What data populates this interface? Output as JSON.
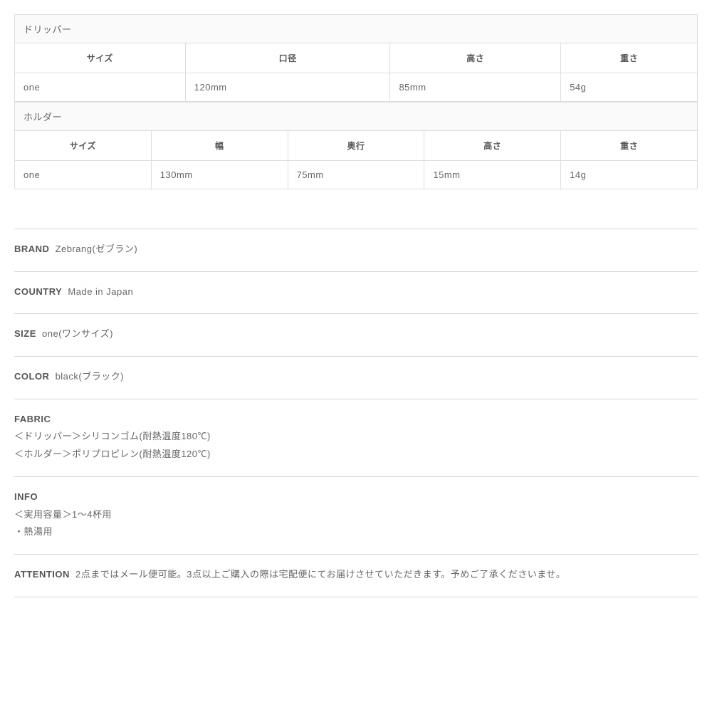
{
  "tables": [
    {
      "title": "ドリッパー",
      "headers": [
        "サイズ",
        "口径",
        "高さ",
        "重さ"
      ],
      "row": [
        "one",
        "120mm",
        "85mm",
        "54g"
      ]
    },
    {
      "title": "ホルダー",
      "headers": [
        "サイズ",
        "幅",
        "奥行",
        "高さ",
        "重さ"
      ],
      "row": [
        "one",
        "130mm",
        "75mm",
        "15mm",
        "14g"
      ]
    }
  ],
  "details": [
    {
      "label": "BRAND",
      "lines": [
        "Zebrang(ゼブラン)"
      ],
      "inline": true
    },
    {
      "label": "COUNTRY",
      "lines": [
        "Made in Japan"
      ],
      "inline": true
    },
    {
      "label": "SIZE",
      "lines": [
        "one(ワンサイズ)"
      ],
      "inline": true
    },
    {
      "label": "COLOR",
      "lines": [
        "black(ブラック)"
      ],
      "inline": true
    },
    {
      "label": "FABRIC",
      "lines": [
        "＜ドリッパー＞シリコンゴム(耐熱温度180℃)",
        "＜ホルダー＞ポリプロピレン(耐熱温度120℃)"
      ],
      "inline": false
    },
    {
      "label": "INFO",
      "lines": [
        "＜実用容量＞1～4杯用",
        "・熱湯用"
      ],
      "inline": false
    },
    {
      "label": "ATTENTION",
      "lines": [
        "2点まではメール便可能。3点以上ご購入の際は宅配便にてお届けさせていただきます。予めご了承くださいませ。"
      ],
      "inline": true
    }
  ]
}
